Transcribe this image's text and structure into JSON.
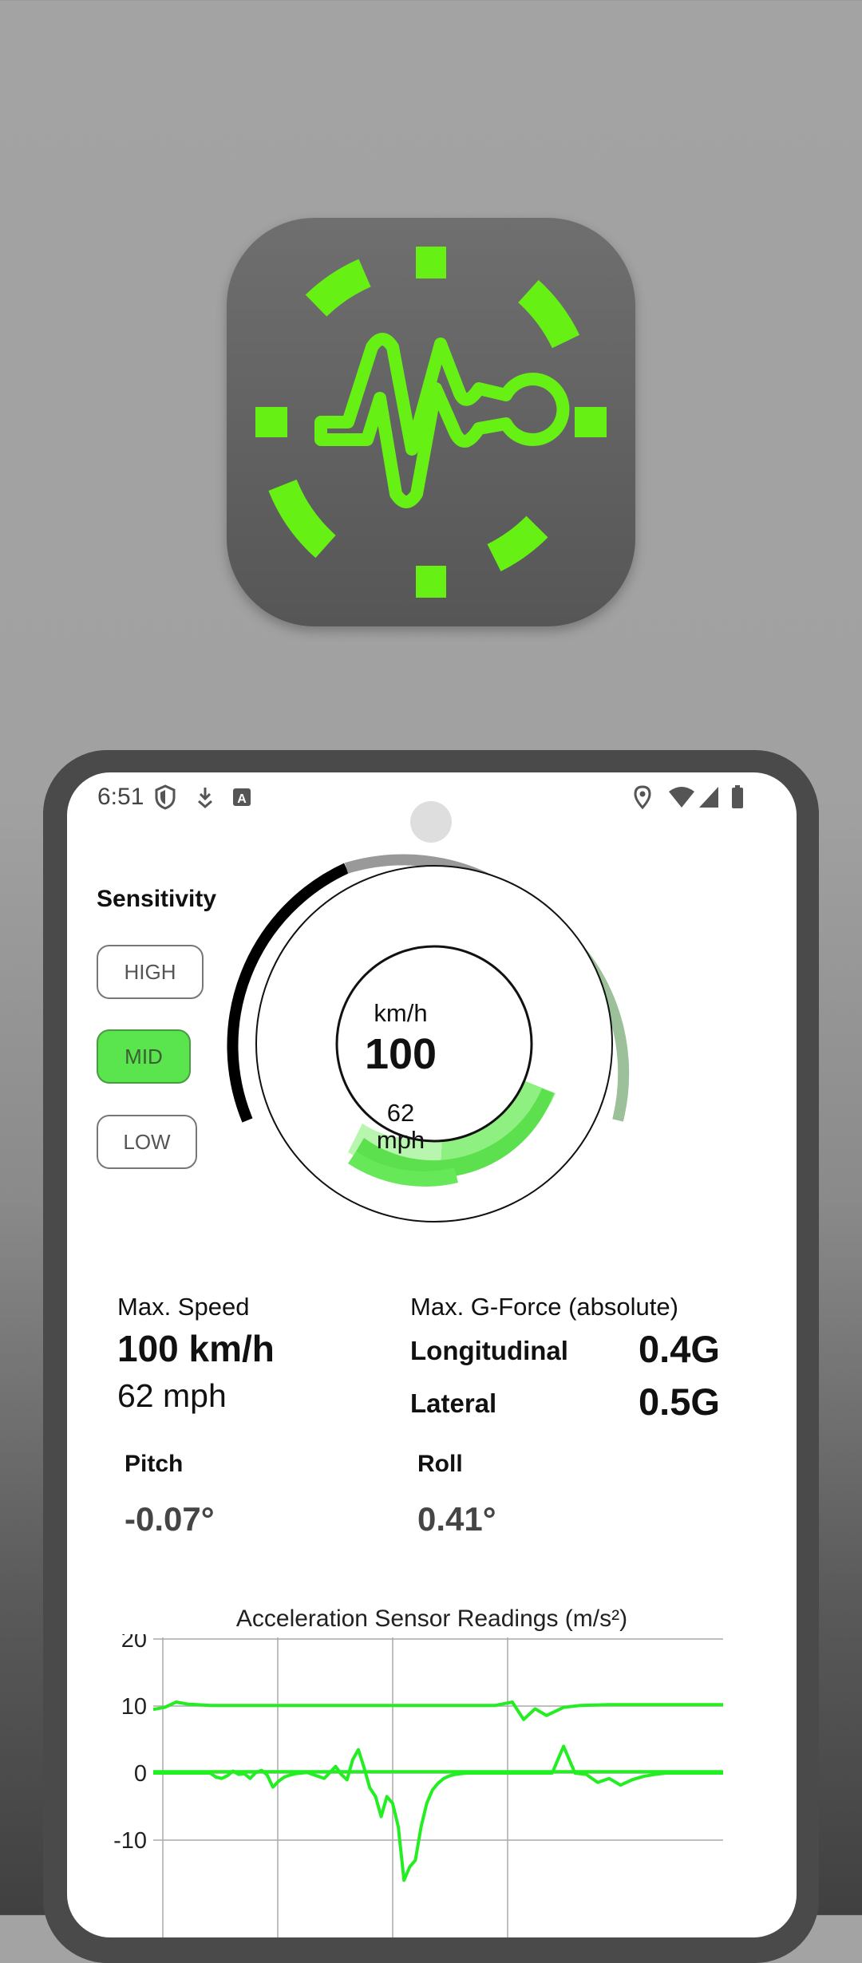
{
  "colors": {
    "accent": "#66f014",
    "chart_line": "#22ee22",
    "button_active": "#5ae44e"
  },
  "status_bar": {
    "time": "6:51",
    "left_icons": [
      "shield-icon",
      "download-icon",
      "font-icon"
    ],
    "right_icons": [
      "location-icon",
      "wifi-icon",
      "signal-icon",
      "battery-icon"
    ]
  },
  "sensitivity": {
    "title": "Sensitivity",
    "options": [
      "HIGH",
      "MID",
      "LOW"
    ],
    "selected": "MID"
  },
  "gauge": {
    "unit": "km/h",
    "speed": "100",
    "mph_value": "62",
    "mph_unit": "mph"
  },
  "stats": {
    "max_speed_label": "Max. Speed",
    "max_speed_kmh": "100 km/h",
    "max_speed_mph": "62 mph",
    "gforce_label": "Max. G-Force (absolute)",
    "longitudinal_label": "Longitudinal",
    "longitudinal_value": "0.4G",
    "lateral_label": "Lateral",
    "lateral_value": "0.5G",
    "pitch_label": "Pitch",
    "pitch_value": "-0.07°",
    "roll_label": "Roll",
    "roll_value": "0.41°"
  },
  "chart_data": {
    "type": "line",
    "title": "Acceleration Sensor Readings (m/s²)",
    "ylim": [
      -20,
      20
    ],
    "yticks": [
      "20",
      "10",
      "0",
      "-10"
    ],
    "series": [
      {
        "x": [
          0,
          2,
          4,
          6,
          10,
          20,
          40,
          60,
          63,
          65,
          67,
          69,
          72,
          75,
          80,
          100
        ],
        "values": [
          9.5,
          9.8,
          10.6,
          10.3,
          10.1,
          10.1,
          10.1,
          10.1,
          10.6,
          8.0,
          9.6,
          8.6,
          9.8,
          10.1,
          10.2,
          10.2
        ]
      },
      {
        "x": [
          0,
          10,
          11,
          12,
          13,
          14,
          15,
          16,
          17,
          18,
          19,
          20,
          21,
          22,
          23,
          24,
          25,
          26,
          27,
          28,
          29,
          30,
          31,
          32,
          33,
          34,
          35,
          36,
          37,
          38,
          39,
          40,
          41,
          42,
          43,
          44,
          45,
          46,
          47,
          48,
          49,
          50,
          51,
          52,
          53,
          54,
          55,
          56,
          57,
          58,
          59,
          60,
          62,
          64,
          66,
          68,
          70,
          72,
          74,
          76,
          78,
          80,
          82,
          84,
          86,
          88,
          90,
          100
        ],
        "values": [
          0,
          0,
          -0.6,
          -0.8,
          -0.4,
          0.3,
          -0.2,
          -0.1,
          -0.8,
          0.1,
          0.4,
          -0.3,
          -2.1,
          -1.2,
          -0.6,
          -0.3,
          -0.1,
          0,
          0.1,
          -0.2,
          -0.5,
          -0.8,
          0.1,
          1.0,
          -0.2,
          -1.0,
          2.0,
          3.5,
          0.8,
          -2.2,
          -3.5,
          -6.5,
          -3.5,
          -4.5,
          -8.0,
          -16.0,
          -14.0,
          -13.0,
          -8.0,
          -4.5,
          -2.5,
          -1.5,
          -0.8,
          -0.4,
          -0.2,
          -0.1,
          0,
          0,
          0,
          0,
          0,
          0,
          0,
          0,
          0,
          0,
          0,
          4.0,
          0,
          -0.2,
          -1.4,
          -0.8,
          -1.8,
          -1.0,
          -0.5,
          -0.2,
          0,
          0
        ]
      },
      {
        "x": [
          0,
          20,
          40,
          60,
          80,
          100
        ],
        "values": [
          0.2,
          0.2,
          0.2,
          0.2,
          0.2,
          0.2
        ]
      }
    ]
  }
}
